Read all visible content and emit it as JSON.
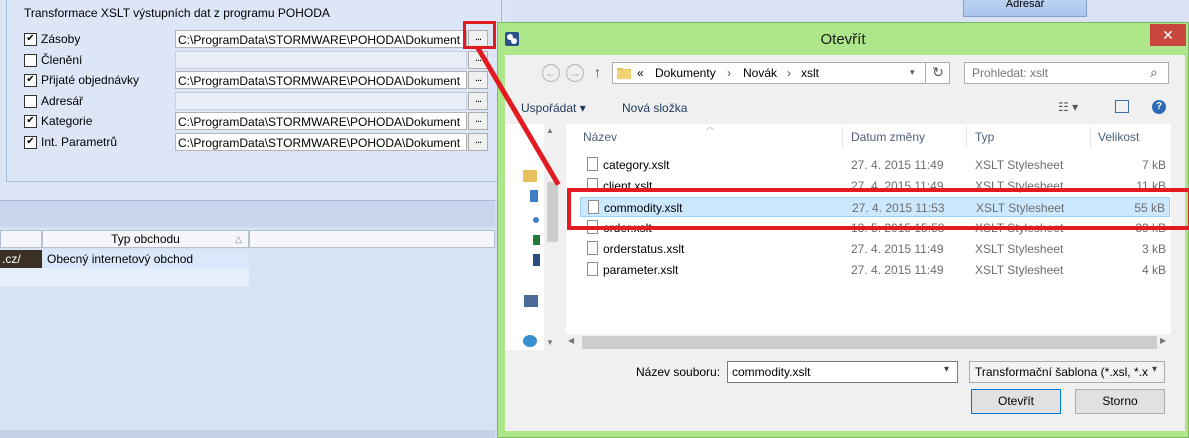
{
  "background_app": {
    "group_title": "Transformace XSLT výstupních dat z programu POHODA",
    "adresar_button": "Adresář",
    "rows": [
      {
        "label": "Zásoby",
        "checked": true,
        "path": "C:\\ProgramData\\STORMWARE\\POHODA\\Dokument"
      },
      {
        "label": "Členění",
        "checked": false,
        "path": ""
      },
      {
        "label": "Přijaté objednávky",
        "checked": true,
        "path": "C:\\ProgramData\\STORMWARE\\POHODA\\Dokument"
      },
      {
        "label": "Adresář",
        "checked": false,
        "path": ""
      },
      {
        "label": "Kategorie",
        "checked": true,
        "path": "C:\\ProgramData\\STORMWARE\\POHODA\\Dokument"
      },
      {
        "label": "Int. Parametrů",
        "checked": true,
        "path": "C:\\ProgramData\\STORMWARE\\POHODA\\Dokument"
      }
    ],
    "browse_label": "...",
    "table": {
      "header": "Typ obchodu",
      "cell_left": ".cz/",
      "cell_right": "Obecný internetový obchod"
    }
  },
  "dialog": {
    "title": "Otevřít",
    "close": "✕",
    "breadcrumb": [
      "«",
      "Dokumenty",
      "›",
      "Novák",
      "›",
      "xslt"
    ],
    "search_placeholder": "Prohledat: xslt",
    "toolbar": {
      "organize": "Uspořádat ▾",
      "new_folder": "Nová složka"
    },
    "columns": {
      "name": "Název",
      "date": "Datum změny",
      "type": "Typ",
      "size": "Velikost"
    },
    "files": [
      {
        "name": "category.xslt",
        "date": "27. 4. 2015 11:49",
        "type": "XSLT Stylesheet",
        "size": "7 kB"
      },
      {
        "name": "client.xslt",
        "date": "27. 4. 2015 11:49",
        "type": "XSLT Stylesheet",
        "size": "11 kB"
      },
      {
        "name": "commodity.xslt",
        "date": "27. 4. 2015 11:53",
        "type": "XSLT Stylesheet",
        "size": "55 kB"
      },
      {
        "name": "order.xslt",
        "date": "13. 5. 2015 15:58",
        "type": "XSLT Stylesheet",
        "size": "39 kB"
      },
      {
        "name": "orderstatus.xslt",
        "date": "27. 4. 2015 11:49",
        "type": "XSLT Stylesheet",
        "size": "3 kB"
      },
      {
        "name": "parameter.xslt",
        "date": "27. 4. 2015 11:49",
        "type": "XSLT Stylesheet",
        "size": "4 kB"
      }
    ],
    "selected_file": "commodity.xslt",
    "filename_label": "Název souboru:",
    "filename_value": "commodity.xslt",
    "filter_value": "Transformační šablona (*.xsl, *.x",
    "open_button": "Otevřít",
    "cancel_button": "Storno"
  },
  "colors": {
    "annotation": "#e21b22",
    "title_bar": "#aee68a",
    "selection": "#cce8ff"
  }
}
